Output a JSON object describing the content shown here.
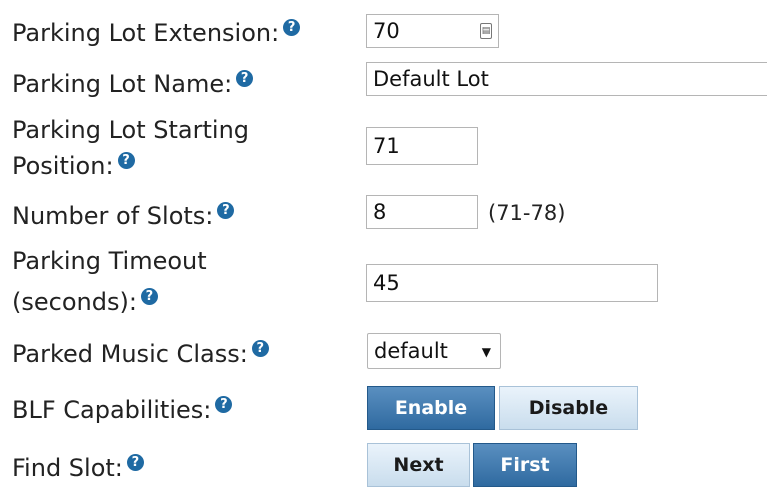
{
  "help_glyph": "?",
  "fields": {
    "extension": {
      "label": "Parking Lot Extension:",
      "value": "70",
      "icon": "calculator-icon"
    },
    "name": {
      "label": "Parking Lot Name:",
      "value": "Default Lot"
    },
    "start": {
      "label1": "Parking Lot Starting",
      "label2": "Position:",
      "value": "71"
    },
    "slots": {
      "label": "Number of Slots:",
      "value": "8",
      "range": "(71-78)"
    },
    "timeout": {
      "label1": "Parking Timeout",
      "label2": "(seconds):",
      "value": "45"
    },
    "music": {
      "label": "Parked Music Class:",
      "selected": "default"
    },
    "blf": {
      "label": "BLF Capabilities:",
      "enable": "Enable",
      "disable": "Disable",
      "active": "Enable"
    },
    "findslot": {
      "label": "Find Slot:",
      "next": "Next",
      "first": "First",
      "active": "First"
    }
  },
  "colors": {
    "help": "#1f6aa3",
    "active_button": "#3a74aa",
    "inactive_button": "#d6e6f3"
  }
}
